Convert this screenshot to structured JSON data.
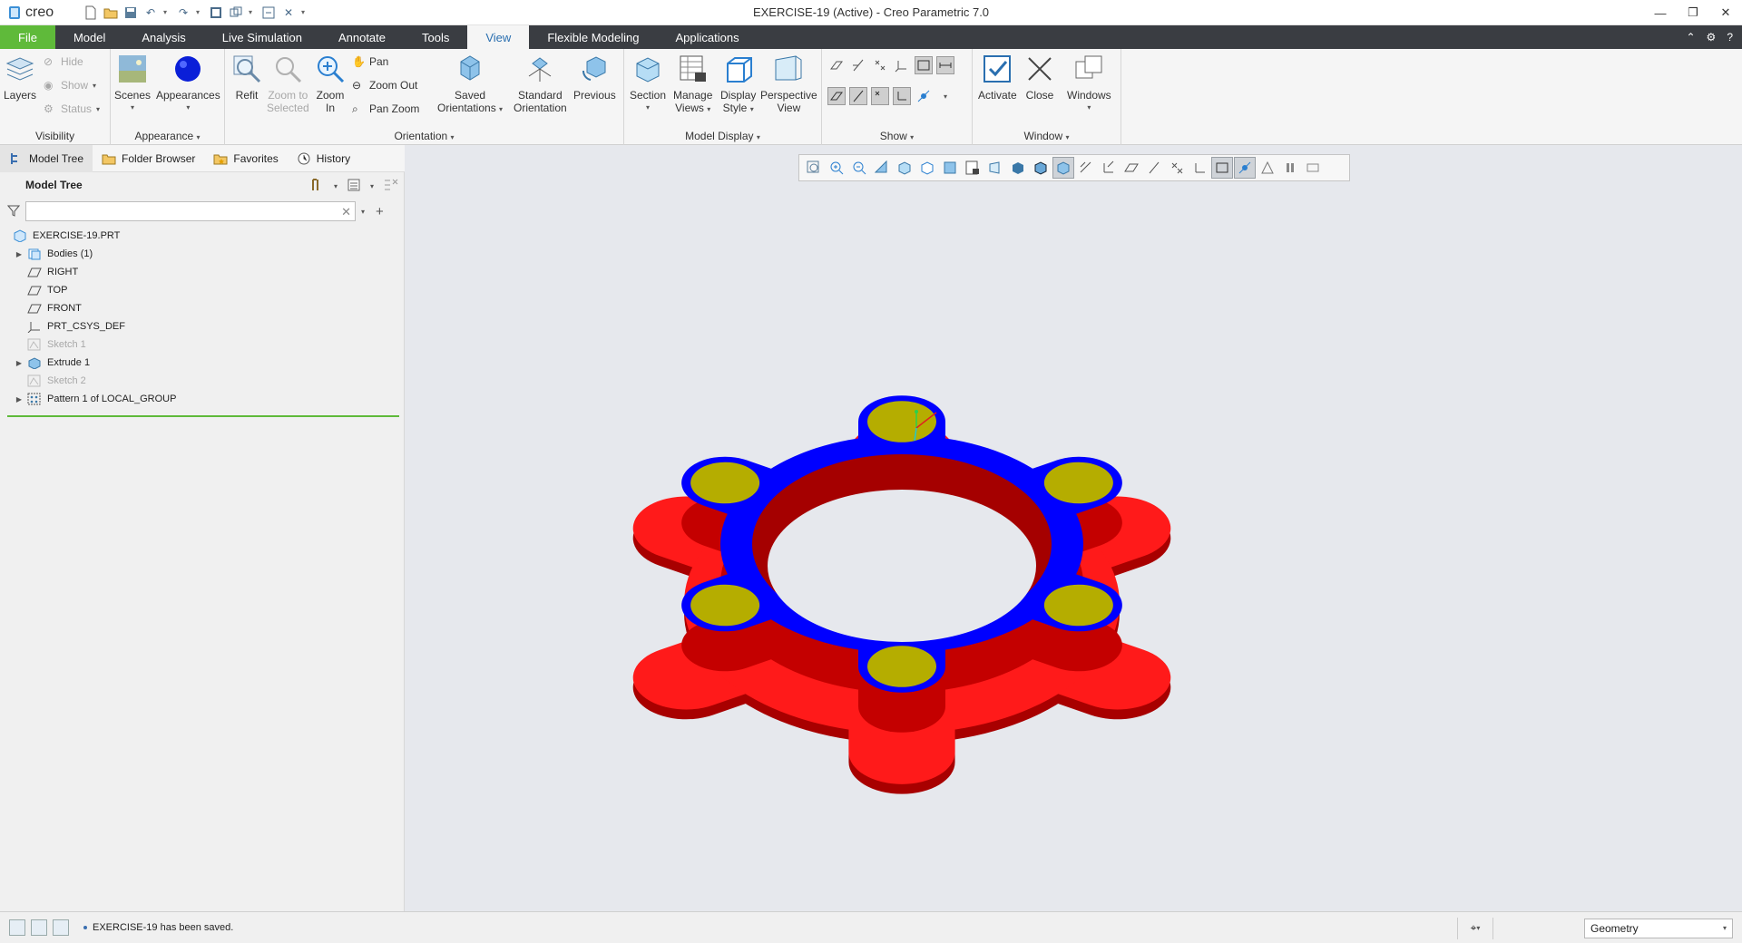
{
  "app": {
    "logo_text": "creo",
    "window_title": "EXERCISE-19 (Active) - Creo Parametric 7.0"
  },
  "ribbon_tabs": [
    "File",
    "Model",
    "Analysis",
    "Live Simulation",
    "Annotate",
    "Tools",
    "View",
    "Flexible Modeling",
    "Applications"
  ],
  "active_tab": "View",
  "ribbon": {
    "visibility": {
      "label": "Visibility",
      "layers": "Layers",
      "hide": "Hide",
      "show": "Show",
      "status": "Status"
    },
    "appearance": {
      "label": "Appearance",
      "scenes": "Scenes",
      "appearances": "Appearances"
    },
    "orientation": {
      "label": "Orientation",
      "refit": "Refit",
      "zoom_to_selected": [
        "Zoom to",
        "Selected"
      ],
      "zoom_in": [
        "Zoom",
        "In"
      ],
      "pan": "Pan",
      "zoom_out": "Zoom Out",
      "pan_zoom": "Pan Zoom",
      "saved_orientations": [
        "Saved",
        "Orientations"
      ],
      "standard_orientation": [
        "Standard",
        "Orientation"
      ],
      "previous": "Previous"
    },
    "model_display": {
      "label": "Model Display",
      "section": "Section",
      "manage_views": [
        "Manage",
        "Views"
      ],
      "display_style": [
        "Display",
        "Style"
      ],
      "perspective_view": [
        "Perspective",
        "View"
      ]
    },
    "show": {
      "label": "Show"
    },
    "window": {
      "label": "Window",
      "activate": "Activate",
      "close": "Close",
      "windows": "Windows"
    }
  },
  "sub_tabs": [
    "Model Tree",
    "Folder Browser",
    "Favorites",
    "History"
  ],
  "model_tree": {
    "title": "Model Tree",
    "search_value": "",
    "items": [
      {
        "label": "EXERCISE-19.PRT",
        "expandable": false,
        "dim": false,
        "indent": 0,
        "icon": "part-icon"
      },
      {
        "label": "Bodies (1)",
        "expandable": true,
        "dim": false,
        "indent": 1,
        "icon": "bodies-icon"
      },
      {
        "label": "RIGHT",
        "expandable": false,
        "dim": false,
        "indent": 1,
        "icon": "datum-plane-icon"
      },
      {
        "label": "TOP",
        "expandable": false,
        "dim": false,
        "indent": 1,
        "icon": "datum-plane-icon"
      },
      {
        "label": "FRONT",
        "expandable": false,
        "dim": false,
        "indent": 1,
        "icon": "datum-plane-icon"
      },
      {
        "label": "PRT_CSYS_DEF",
        "expandable": false,
        "dim": false,
        "indent": 1,
        "icon": "csys-icon"
      },
      {
        "label": "Sketch 1",
        "expandable": false,
        "dim": true,
        "indent": 1,
        "icon": "sketch-icon"
      },
      {
        "label": "Extrude 1",
        "expandable": true,
        "dim": false,
        "indent": 1,
        "icon": "extrude-icon"
      },
      {
        "label": "Sketch 2",
        "expandable": false,
        "dim": true,
        "indent": 1,
        "icon": "sketch-icon"
      },
      {
        "label": "Pattern 1 of LOCAL_GROUP",
        "expandable": true,
        "dim": false,
        "indent": 1,
        "icon": "pattern-icon"
      }
    ]
  },
  "status": {
    "message": "EXERCISE-19 has been saved.",
    "selection_filter": "Geometry"
  },
  "colors": {
    "top_face": "#0000ff",
    "side_face": "#ff0000",
    "hole_face": "#b5ad00",
    "file_tab": "#5fba3a",
    "tab_bar": "#3a3d42"
  }
}
